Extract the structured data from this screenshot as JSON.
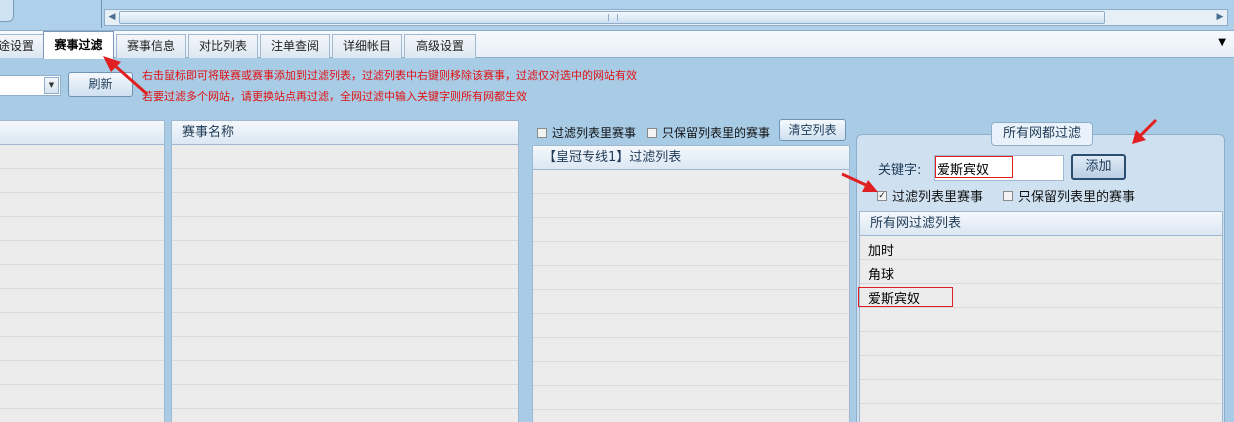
{
  "tabs": [
    {
      "label": "途设置",
      "active": false
    },
    {
      "label": "赛事过滤",
      "active": true
    },
    {
      "label": "赛事信息",
      "active": false
    },
    {
      "label": "对比列表",
      "active": false
    },
    {
      "label": "注单查阅",
      "active": false
    },
    {
      "label": "详细帐目",
      "active": false
    },
    {
      "label": "高级设置",
      "active": false
    }
  ],
  "toolbar": {
    "refresh_label": "刷新",
    "hint_line1": "右击鼠标即可将联赛或赛事添加到过滤列表，过滤列表中右键则移除该赛事，过滤仅对选中的网站有效",
    "hint_line2": "若要过滤多个网站，请更换站点再过滤，全网过滤中输入关键字则所有网都生效"
  },
  "match_grid": {
    "header": "赛事名称"
  },
  "filter_panel": {
    "filter_in_list_label": "过滤列表里赛事",
    "filter_in_list_checked": false,
    "keep_only_label": "只保留列表里的赛事",
    "keep_only_checked": false,
    "clear_label": "清空列表",
    "list_header": "【皇冠专线1】过滤列表"
  },
  "global_filter": {
    "group_title": "所有网都过滤",
    "keyword_label": "关键字:",
    "keyword_value": "爱斯宾奴",
    "add_label": "添加",
    "filter_in_list_label": "过滤列表里赛事",
    "filter_in_list_checked": true,
    "keep_only_label": "只保留列表里的赛事",
    "keep_only_checked": false,
    "list_header": "所有网过滤列表",
    "items": [
      "加时",
      "角球",
      "爱斯宾奴"
    ]
  },
  "colors": {
    "background": "#a9cce6",
    "hint_text": "#e01010",
    "highlight": "#e02020"
  }
}
